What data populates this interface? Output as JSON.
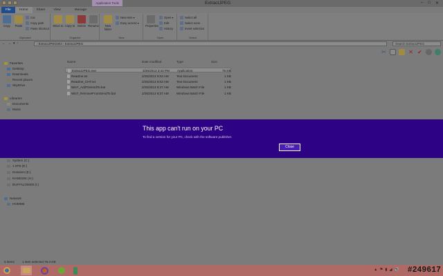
{
  "window": {
    "title": "ExtractJPEG",
    "context_tab": "Application Tools",
    "controls": [
      "–",
      "□",
      "✕"
    ]
  },
  "ribbon_tabs": [
    "File",
    "Home",
    "Share",
    "View",
    "Manage"
  ],
  "ribbon": {
    "clipboard": {
      "label": "Clipboard",
      "copy": "Copy",
      "paste": "Paste",
      "cut": "Cut",
      "copy_path": "Copy path",
      "paste_shortcut": "Paste shortcut"
    },
    "organize": {
      "label": "Organize",
      "move_to": "Move to",
      "copy_to": "Copy to",
      "delete": "Delete",
      "rename": "Rename"
    },
    "new": {
      "label": "New",
      "new_folder": "New folder",
      "new_item": "New item",
      "easy_access": "Easy access"
    },
    "open": {
      "label": "Open",
      "properties": "Properties",
      "open": "Open",
      "edit": "Edit",
      "history": "History"
    },
    "select": {
      "label": "Select",
      "select_all": "Select all",
      "select_none": "Select none",
      "invert_selection": "Invert selection"
    }
  },
  "address": {
    "path": "›  ExtractJPEG002  ›  ExtractJPEG",
    "search_placeholder": "Search ExtractJPEG"
  },
  "nav_pane": {
    "favorites_header": "Favorites",
    "favorites": [
      "Desktop",
      "Downloads",
      "Recent places",
      "SkyDrive"
    ],
    "libraries_header": "Libraries",
    "libraries": [
      "Documents",
      "Music"
    ],
    "computer_header": "Computer",
    "drives": [
      "System (C:)",
      "1.5TB (D:)",
      "Dossiers (E:)",
      "RAMDISK (H:)",
      "BUFFALO5000 (I:)"
    ],
    "network_header": "Network",
    "network": [
      "HOMME"
    ]
  },
  "columns": [
    "Name",
    "Date modified",
    "Type",
    "Size"
  ],
  "files": [
    {
      "name": "ExtractJPEG.exe",
      "date": "3/26/2013 3:42 PM",
      "type": "Application",
      "size": "76 KB"
    },
    {
      "name": "Readme.txt",
      "date": "2/25/2013 9:02 AM",
      "type": "Text Document",
      "size": "1 KB"
    },
    {
      "name": "Readme_CHT.txt",
      "date": "2/25/2013 9:02 AM",
      "type": "Text Document",
      "size": "1 KB"
    },
    {
      "name": "Win7_AddToSendTo.bat",
      "date": "2/25/2013 8:37 AM",
      "type": "Windows Batch File",
      "size": "1 KB"
    },
    {
      "name": "Win7_RemoveFromSendTo.bat",
      "date": "2/25/2013 8:37 AM",
      "type": "Windows Batch File",
      "size": "1 KB"
    }
  ],
  "status": {
    "items": "5 items",
    "selected": "1 item selected  75.3 KB"
  },
  "dialog": {
    "title": "This app can't run on your PC",
    "message": "To find a version for your PC, check with the software publisher.",
    "close_label": "Close"
  },
  "taskbar": {
    "pinned": [
      "internet-explorer-icon",
      "file-explorer-icon",
      "firefox-icon",
      "utorrent-icon",
      "running-app-icon"
    ],
    "tray_glyphs": [
      "▲",
      "⚑",
      "▮",
      "◢",
      "🔊"
    ],
    "watermark": "#249617"
  },
  "colors": {
    "dialog_bg": "#2e0284",
    "taskbar_bg": "#b06a65",
    "file_tab": "#1f4d8c"
  }
}
